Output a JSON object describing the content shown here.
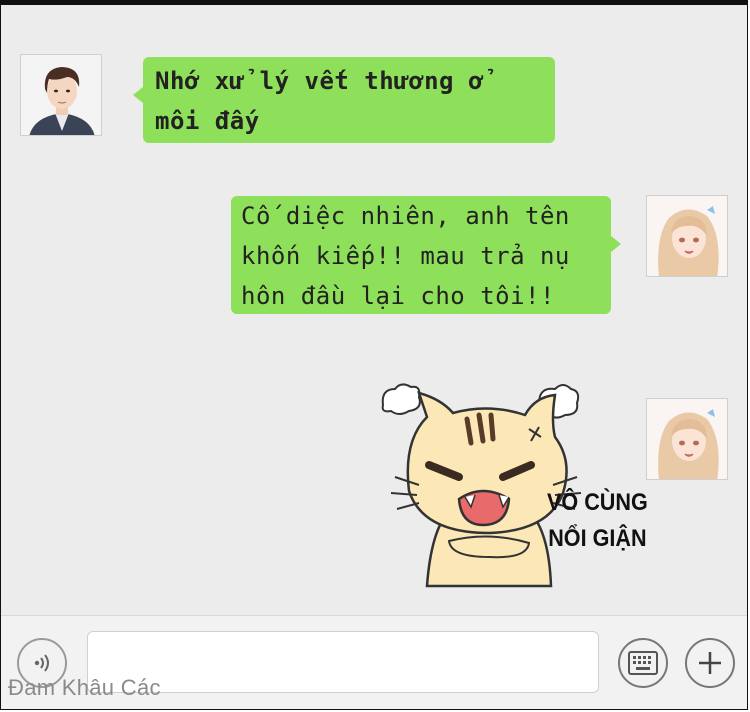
{
  "messages": [
    {
      "sender": "contact",
      "lines": [
        "Nhớ xử lý vết thương ở",
        "môi đấy"
      ]
    },
    {
      "sender": "me",
      "lines": [
        "Cố diệc nhiên, anh tên",
        "khốn kiếp!! mau trả nụ",
        "hôn đầu lại cho tôi!!"
      ]
    },
    {
      "sender": "me",
      "sticker": "angry-cat-sticker",
      "sticker_caption": [
        "VÔ CÙNG",
        "NỔI GIẬN"
      ]
    }
  ],
  "input_bar": {
    "voice_icon": "voice-icon",
    "keyboard_icon": "keyboard-icon",
    "plus_icon": "plus-icon"
  },
  "watermark": "Đam Khâu Các",
  "colors": {
    "bubble": "#8ee05a",
    "chat_background": "#ececec"
  }
}
